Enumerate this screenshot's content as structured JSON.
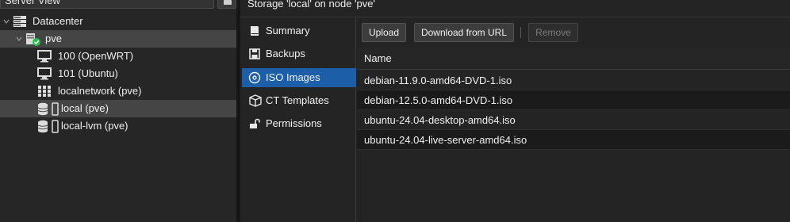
{
  "tree": {
    "view_selector": "Server View",
    "datacenter": "Datacenter",
    "node": "pve",
    "items": [
      {
        "label": "100 (OpenWRT)"
      },
      {
        "label": "101 (Ubuntu)"
      },
      {
        "label": "localnetwork (pve)"
      },
      {
        "label": "local (pve)"
      },
      {
        "label": "local-lvm (pve)"
      }
    ]
  },
  "content": {
    "title": "Storage 'local' on node 'pve'"
  },
  "nav": {
    "items": [
      {
        "label": "Summary",
        "icon": "book-icon"
      },
      {
        "label": "Backups",
        "icon": "floppy-icon"
      },
      {
        "label": "ISO Images",
        "icon": "disc-icon"
      },
      {
        "label": "CT Templates",
        "icon": "cube-icon"
      },
      {
        "label": "Permissions",
        "icon": "unlock-icon"
      }
    ],
    "active": "ISO Images"
  },
  "toolbar": {
    "upload": "Upload",
    "download_url": "Download from URL",
    "remove": "Remove"
  },
  "grid": {
    "column_name": "Name",
    "rows": [
      "debian-11.9.0-amd64-DVD-1.iso",
      "debian-12.5.0-amd64-DVD-1.iso",
      "ubuntu-24.04-desktop-amd64.iso",
      "ubuntu-24.04-live-server-amd64.iso"
    ]
  },
  "colors": {
    "accent": "#1c5fa8",
    "status_ok": "#21bf4b",
    "background": "#242424"
  }
}
